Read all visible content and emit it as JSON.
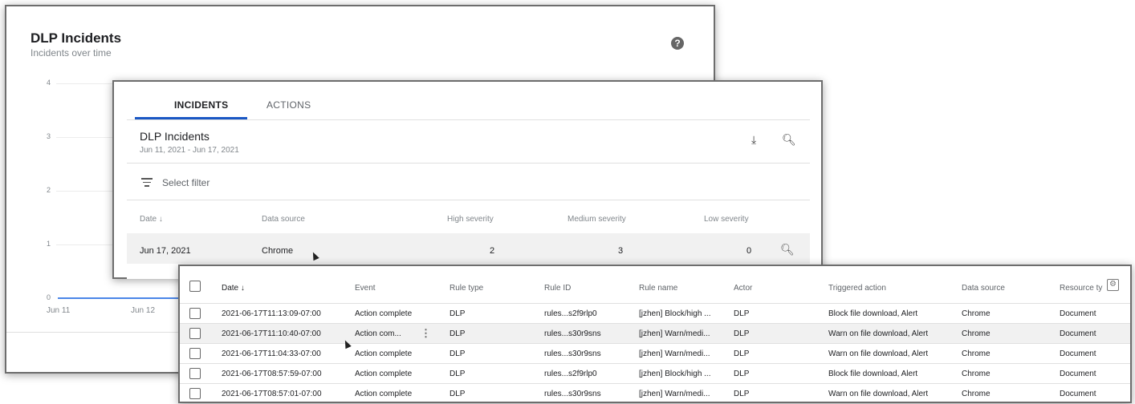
{
  "chart_panel": {
    "title": "DLP Incidents",
    "subtitle": "Incidents over time",
    "help_glyph": "?",
    "y_ticks": [
      "4",
      "3",
      "2",
      "1",
      "0"
    ],
    "x_ticks": [
      "Jun 11",
      "Jun 12"
    ]
  },
  "chart_data": {
    "type": "line",
    "title": "DLP Incidents",
    "subtitle": "Incidents over time",
    "x": [
      "Jun 11",
      "Jun 12"
    ],
    "series": [
      {
        "values": [
          0,
          0
        ]
      }
    ],
    "ylim": [
      0,
      4
    ],
    "grid": true
  },
  "summary_panel": {
    "tabs": [
      {
        "label": "INCIDENTS",
        "active": true
      },
      {
        "label": "ACTIONS",
        "active": false
      }
    ],
    "card_title": "DLP Incidents",
    "card_subtitle": "Jun 11, 2021 - Jun 17, 2021",
    "filter_placeholder": "Select filter",
    "columns": [
      "Date ↓",
      "Data source",
      "High severity",
      "Medium severity",
      "Low severity"
    ],
    "rows": [
      {
        "date": "Jun 17, 2021",
        "source": "Chrome",
        "high": "2",
        "medium": "3",
        "low": "0"
      }
    ]
  },
  "detail_table": {
    "columns": [
      "Date ↓",
      "Event",
      "Rule type",
      "Rule ID",
      "Rule name",
      "Actor",
      "Triggered action",
      "Data source",
      "Resource ty"
    ],
    "rows": [
      {
        "date": "2021-06-17T11:13:09-07:00",
        "event": "Action complete",
        "rule_type": "DLP",
        "rule_id": "rules...s2f9rlp0",
        "rule_name": "[jzhen] Block/high ...",
        "actor": "DLP",
        "action": "Block file download, Alert",
        "source": "Chrome",
        "resource": "Document"
      },
      {
        "date": "2021-06-17T11:10:40-07:00",
        "event": "Action com...",
        "rule_type": "DLP",
        "rule_id": "rules...s30r9sns",
        "rule_name": "[jzhen] Warn/medi...",
        "actor": "DLP",
        "action": "Warn on file download, Alert",
        "source": "Chrome",
        "resource": "Document"
      },
      {
        "date": "2021-06-17T11:04:33-07:00",
        "event": "Action complete",
        "rule_type": "DLP",
        "rule_id": "rules...s30r9sns",
        "rule_name": "[jzhen] Warn/medi...",
        "actor": "DLP",
        "action": "Warn on file download, Alert",
        "source": "Chrome",
        "resource": "Document"
      },
      {
        "date": "2021-06-17T08:57:59-07:00",
        "event": "Action complete",
        "rule_type": "DLP",
        "rule_id": "rules...s2f9rlp0",
        "rule_name": "[jzhen] Block/high ...",
        "actor": "DLP",
        "action": "Block file download, Alert",
        "source": "Chrome",
        "resource": "Document"
      },
      {
        "date": "2021-06-17T08:57:01-07:00",
        "event": "Action complete",
        "rule_type": "DLP",
        "rule_id": "rules...s30r9sns",
        "rule_name": "[jzhen] Warn/medi...",
        "actor": "DLP",
        "action": "Warn on file download, Alert",
        "source": "Chrome",
        "resource": "Document"
      }
    ]
  },
  "icons": {
    "help": "help-icon",
    "download": "download-icon",
    "zoom": "zoom-icon",
    "filter": "filter-icon",
    "settings": "column-settings-icon",
    "more": "more-vert-icon"
  },
  "colors": {
    "accent": "#1a57c4",
    "line": "#4a86e8",
    "row_highlight": "#f1f1f1"
  }
}
